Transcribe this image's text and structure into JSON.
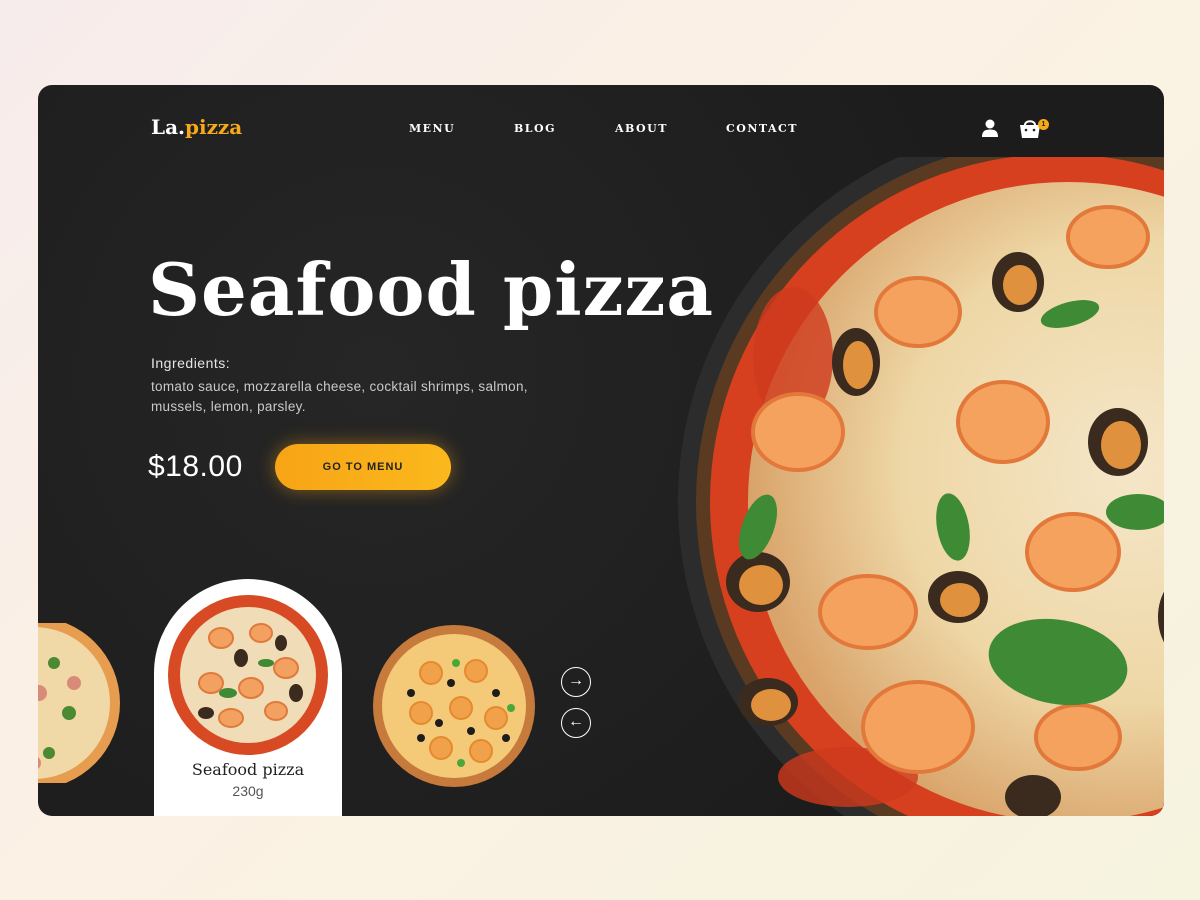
{
  "brand": {
    "logo_main": "La.",
    "logo_accent": "pizza",
    "accent_color": "#f6a91a"
  },
  "nav": {
    "items": [
      {
        "label": "MENU"
      },
      {
        "label": "BLOG"
      },
      {
        "label": "ABOUT"
      },
      {
        "label": "CONTACT"
      }
    ]
  },
  "header": {
    "cart_count": "1",
    "user_icon": "user-icon",
    "cart_icon": "shopping-bag-icon"
  },
  "hero": {
    "title": "Seafood pizza",
    "ingredients_label": "Ingredients:",
    "ingredients": "tomato sauce, mozzarella cheese, cocktail shrimps, salmon, mussels, lemon, parsley.",
    "price": "$18.00",
    "cta_label": "GO TO MENU"
  },
  "carousel": {
    "active": {
      "name": "Seafood pizza",
      "weight": "230g"
    },
    "next_icon": "arrow-right-icon",
    "prev_icon": "arrow-left-icon"
  }
}
